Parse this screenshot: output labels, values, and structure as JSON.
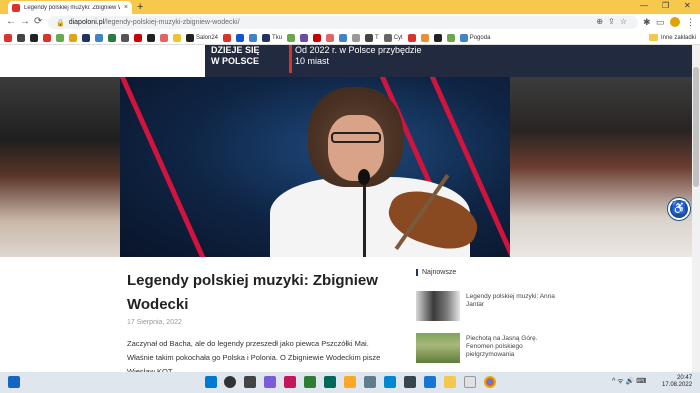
{
  "browser": {
    "tab_title": "Legendy polskiej muzyki: Zbigniew W",
    "tab_close": "×",
    "new_tab": "+",
    "window_controls": [
      "—",
      "❐",
      "✕"
    ],
    "url_host": "diapoloni.pl",
    "url_path": "/legendy-polskiej-muzyki-zbigniew-wodecki/",
    "nav": {
      "back": "←",
      "forward": "→",
      "reload": "⟳"
    }
  },
  "bookmarks": {
    "items": [
      {
        "label": "",
        "color": "#d9342b"
      },
      {
        "label": "",
        "color": "#444444"
      },
      {
        "label": "",
        "color": "#222222"
      },
      {
        "label": "",
        "color": "#d9342b"
      },
      {
        "label": "",
        "color": "#6aa84f"
      },
      {
        "label": "",
        "color": "#e3a21a"
      },
      {
        "label": "",
        "color": "#1f3364"
      },
      {
        "label": "",
        "color": "#3d85c6"
      },
      {
        "label": "",
        "color": "#2b7a3e"
      },
      {
        "label": "",
        "color": "#555555"
      },
      {
        "label": "",
        "color": "#cc0000"
      },
      {
        "label": "",
        "color": "#222222"
      },
      {
        "label": "",
        "color": "#e06666"
      },
      {
        "label": "",
        "color": "#f1c232"
      },
      {
        "label": "Salon24",
        "color": "#222222"
      },
      {
        "label": "",
        "color": "#d9342b"
      },
      {
        "label": "",
        "color": "#1155cc"
      },
      {
        "label": "",
        "color": "#3d85c6"
      },
      {
        "label": "Tku",
        "color": "#1f3364"
      },
      {
        "label": "",
        "color": "#6aa84f"
      },
      {
        "label": "",
        "color": "#674ea7"
      },
      {
        "label": "",
        "color": "#cc0000"
      },
      {
        "label": "",
        "color": "#e06666"
      },
      {
        "label": "",
        "color": "#3d85c6"
      },
      {
        "label": "",
        "color": "#999999"
      },
      {
        "label": "T",
        "color": "#444444"
      },
      {
        "label": "Cyt",
        "color": "#666666"
      },
      {
        "label": "",
        "color": "#d9342b"
      },
      {
        "label": "",
        "color": "#e69138"
      },
      {
        "label": "",
        "color": "#222222"
      },
      {
        "label": "",
        "color": "#6aa84f"
      },
      {
        "label": "Pogoda",
        "color": "#3d85c6"
      }
    ],
    "other_folder": "Inne zakładki"
  },
  "banner": {
    "left_lines": [
      "DZIEJE SIĘ",
      "W POLSCE"
    ],
    "right_lines": [
      "Od 2022 r. w Polsce przybędzie",
      "10 miast"
    ]
  },
  "article": {
    "title": "Legendy polskiej muzyki: Zbigniew Wodecki",
    "date": "17 Sierpnia, 2022",
    "lead": "Zaczynał od Bacha, ale do legendy przeszedł jako piewca Pszczółki Mai. Właśnie takim pokochała go Polska i Polonia. O Zbigniewie Wodeckim pisze Wiesław KOT."
  },
  "sidebar": {
    "heading": "Najnowsze",
    "items": [
      {
        "title": "Legendy polskiej muzyki: Anna Jantar"
      },
      {
        "title": "Piechotą na Jasną Górę. Fenomen polskiego pielgrzymowania"
      }
    ]
  },
  "accessibility_button": {
    "icon": "accessibility-icon"
  },
  "taskbar": {
    "tray": "^  ᯤ  🔊  ⌨",
    "time": "20:47",
    "date": "17.08.2022"
  }
}
